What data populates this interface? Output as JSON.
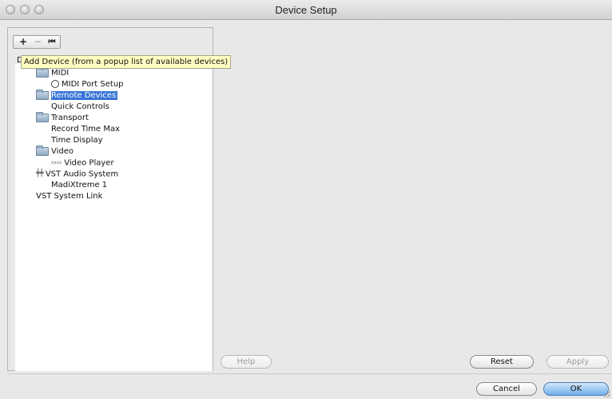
{
  "window": {
    "title": "Device Setup"
  },
  "toolbar": {
    "add_label": "+",
    "remove_label": "−",
    "reset_label": "⏮"
  },
  "tooltip": {
    "cut_letter": "D",
    "text": "Add Device (from a popup list of available devices)"
  },
  "tree": {
    "items": [
      {
        "label": "MIDI",
        "icon": "folder-icon",
        "level": 1
      },
      {
        "label": "MIDI Port Setup",
        "icon": "midi-port-icon",
        "level": 2
      },
      {
        "label": "Remote Devices",
        "icon": "folder-icon",
        "level": 1,
        "selected": true
      },
      {
        "label": "Quick Controls",
        "icon": "",
        "level": 2
      },
      {
        "label": "Transport",
        "icon": "folder-icon",
        "level": 1
      },
      {
        "label": "Record Time Max",
        "icon": "",
        "level": 2
      },
      {
        "label": "Time Display",
        "icon": "",
        "level": 2
      },
      {
        "label": "Video",
        "icon": "folder-icon",
        "level": 1
      },
      {
        "label": "Video Player",
        "icon": "video-icon",
        "level": 2
      },
      {
        "label": "VST Audio System",
        "icon": "vst-audio-icon",
        "level": 1
      },
      {
        "label": "MadiXtreme 1",
        "icon": "",
        "level": 2
      },
      {
        "label": "VST System Link",
        "icon": "",
        "level": 0
      }
    ]
  },
  "buttons": {
    "help": "Help",
    "reset": "Reset",
    "apply": "Apply",
    "cancel": "Cancel",
    "ok": "OK"
  },
  "colors": {
    "selection": "#3875d7",
    "tooltip_bg": "#ffffc2",
    "primary_button": "#6fb0ee"
  }
}
